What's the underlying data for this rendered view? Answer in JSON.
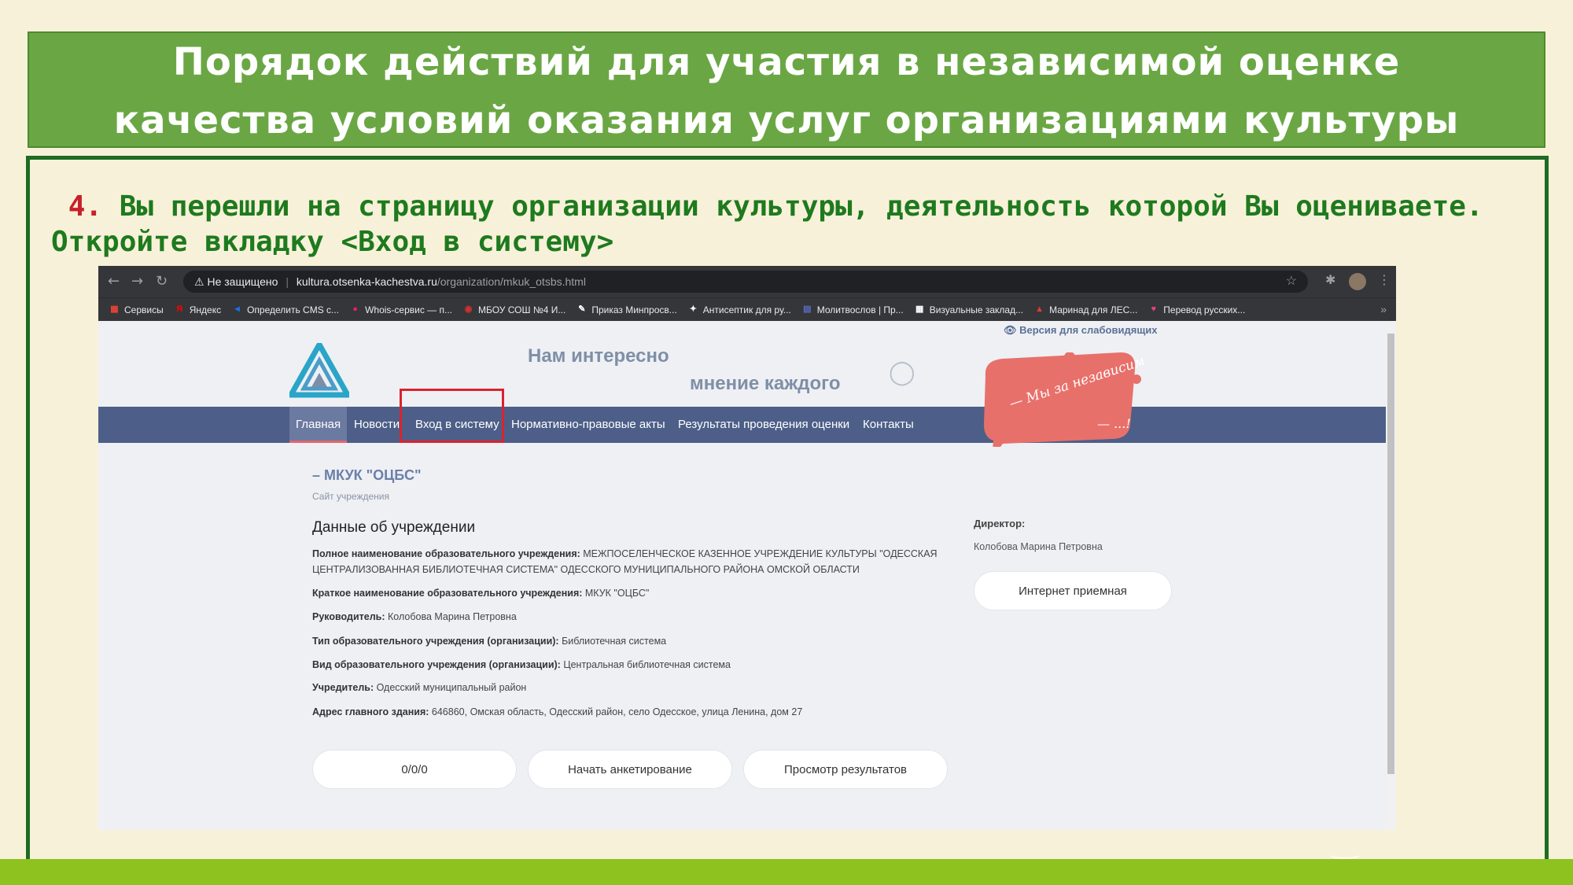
{
  "slide": {
    "title_line1": "Порядок действий для участия в независимой оценке",
    "title_line2": "качества условий оказания услуг организациями культуры",
    "step_number": "4.",
    "instruction_line1": "Вы перешли на страницу организации культуры, деятельность которой  Вы оцениваете.",
    "instruction_line2": "Откройте вкладку <Вход в систему>"
  },
  "browser": {
    "security": "Не защищено",
    "url_domain": "kultura.otsenka-kachestva.ru",
    "url_path": "/organization/mkuk_otsbs.html",
    "bookmarks": [
      {
        "label": "Сервисы",
        "icon": "apps-grid-icon",
        "color": "#ea4335"
      },
      {
        "label": "Яндекс",
        "icon": "yandex-icon",
        "color": "#ff0000"
      },
      {
        "label": "Определить CMS с...",
        "icon": "cms-icon",
        "color": "#1a73e8"
      },
      {
        "label": "Whois-сервис — п...",
        "icon": "whois-icon",
        "color": "#e91e63"
      },
      {
        "label": "МБОУ СОШ №4 И...",
        "icon": "school-icon",
        "color": "#d32f2f"
      },
      {
        "label": "Приказ Минпросв...",
        "icon": "doc-icon",
        "color": "#ffffff"
      },
      {
        "label": "Антисептик для ру...",
        "icon": "sparkle-icon",
        "color": "#ffffff"
      },
      {
        "label": "Молитвослов | Пр...",
        "icon": "book-icon",
        "color": "#5c6bc0"
      },
      {
        "label": "Визуальные заклад...",
        "icon": "tiles-icon",
        "color": "#ffffff"
      },
      {
        "label": "Маринад для ЛЕС...",
        "icon": "recipe-icon",
        "color": "#e53935"
      },
      {
        "label": "Перевод русских...",
        "icon": "heart-icon",
        "color": "#ec407a"
      }
    ]
  },
  "site": {
    "version_link": "Версия для слабовидящих",
    "slogan_line1": "Нам интересно",
    "slogan_line2": "мнение каждого",
    "badge_text": "— Мы за независимую оценку!",
    "badge_text2": "— ...!",
    "nav": [
      "Главная",
      "Новости",
      "Вход в систему",
      "Нормативно-правовые акты",
      "Результаты проведения оценки",
      "Контакты"
    ],
    "org_title": "– МКУК \"ОЦБС\"",
    "org_subtitle": "Сайт учреждения",
    "data_heading": "Данные об учреждении",
    "fields": [
      {
        "label": "Полное наименование образовательного учреждения:",
        "value": "МЕЖПОСЕЛЕНЧЕСКОЕ КАЗЕННОЕ УЧРЕЖДЕНИЕ КУЛЬТУРЫ \"ОДЕССКАЯ ЦЕНТРАЛИЗОВАННАЯ БИБЛИОТЕЧНАЯ СИСТЕМА\" ОДЕССКОГО МУНИЦИПАЛЬНОГО РАЙОНА ОМСКОЙ ОБЛАСТИ"
      },
      {
        "label": "Краткое наименование образовательного учреждения:",
        "value": "МКУК \"ОЦБС\""
      },
      {
        "label": "Руководитель:",
        "value": "Колобова Марина Петровна"
      },
      {
        "label": "Тип образовательного учреждения (организации):",
        "value": "Библиотечная система"
      },
      {
        "label": "Вид образовательного учреждения (организации):",
        "value": "Центральная библиотечная система"
      },
      {
        "label": "Учредитель:",
        "value": "Одесский муниципальный район"
      },
      {
        "label": "Адрес главного здания:",
        "value": "646860, Омская область, Одесский район, село Одесское, улица Ленина, дом 27"
      }
    ],
    "director_label": "Директор:",
    "director_name": "Колобова Марина Петровна",
    "reception_button": "Интернет приемная",
    "counter_button": "0/0/0",
    "start_survey_button": "Начать анкетирование",
    "view_results_button": "Просмотр результатов"
  },
  "colors": {
    "header_green": "#6aa744",
    "frame_green": "#1e6b24",
    "instruction_green": "#1e7a1e",
    "step_red": "#c8202a",
    "navbar": "#4d5f88",
    "highlight_red": "#d9232e",
    "bottom_bar": "#8dc21f"
  }
}
